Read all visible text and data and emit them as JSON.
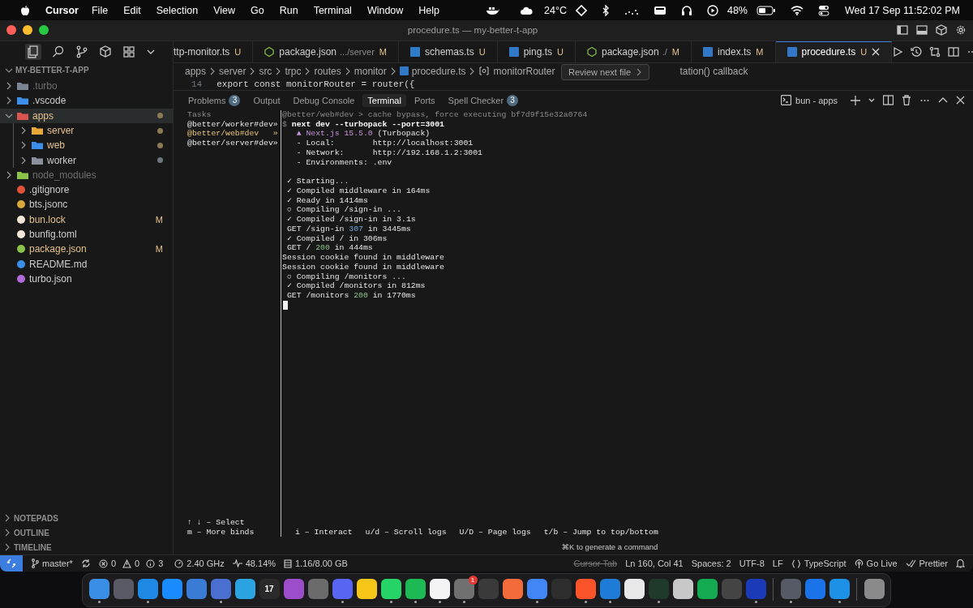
{
  "menu_bar": {
    "app": "Cursor",
    "menus": [
      "File",
      "Edit",
      "Selection",
      "View",
      "Go",
      "Run",
      "Terminal",
      "Window",
      "Help"
    ],
    "weather": "24°C",
    "battery": "48%",
    "clock": "Wed 17 Sep  11:52:02 PM"
  },
  "window": {
    "title": "procedure.ts — my-better-t-app"
  },
  "tabs": [
    {
      "label": "ttp-monitor.ts",
      "status": "U",
      "kind": "plain",
      "selected": false
    },
    {
      "label": "package.json",
      "detail": ".../server",
      "status": "M",
      "kind": "json",
      "selected": false
    },
    {
      "label": "schemas.ts",
      "status": "U",
      "kind": "ts",
      "selected": false
    },
    {
      "label": "ping.ts",
      "status": "U",
      "kind": "ts",
      "selected": false
    },
    {
      "label": "package.json",
      "detail": "./",
      "status": "M",
      "kind": "json",
      "selected": false
    },
    {
      "label": "index.ts",
      "status": "M",
      "kind": "ts",
      "selected": false
    },
    {
      "label": "procedure.ts",
      "status": "U",
      "kind": "ts",
      "selected": true
    }
  ],
  "tooltip": "Review next file",
  "breadcrumb": [
    "apps",
    "server",
    "src",
    "trpc",
    "routes",
    "monitor",
    "procedure.ts",
    "monitorRouter",
    "tation() callback"
  ],
  "code": {
    "line_number": "14",
    "text": "export const monitorRouter = router({"
  },
  "explorer": {
    "title": "MY-BETTER-T-APP",
    "items": [
      {
        "label": ".turbo",
        "kind": "folder",
        "color": "#7b8493",
        "dimmed": true,
        "modified": false,
        "expanded": false
      },
      {
        "label": ".vscode",
        "kind": "folder",
        "color": "#3b8eea",
        "dimmed": false,
        "modified": false,
        "expanded": false
      },
      {
        "label": "apps",
        "kind": "folder",
        "color": "#d9534f",
        "dimmed": false,
        "modified": true,
        "expanded": true,
        "changed": true,
        "children": [
          {
            "label": "server",
            "kind": "folder",
            "color": "#e8a838",
            "dimmed": false,
            "modified": true,
            "expanded": false,
            "changed": true
          },
          {
            "label": "web",
            "kind": "folder",
            "color": "#3b8eea",
            "dimmed": false,
            "modified": true,
            "expanded": false,
            "changed": true
          },
          {
            "label": "worker",
            "kind": "folder",
            "color": "#8a919c",
            "dimmed": false,
            "modified": false,
            "expanded": false,
            "changed": true
          }
        ]
      },
      {
        "label": "node_modules",
        "kind": "folder",
        "color": "#8bc34a",
        "dimmed": true,
        "modified": false,
        "expanded": false
      },
      {
        "label": ".gitignore",
        "kind": "file",
        "color": "#e0523a",
        "dimmed": false,
        "modified": false
      },
      {
        "label": "bts.jsonc",
        "kind": "file",
        "color": "#d9a83a",
        "dimmed": false,
        "modified": false
      },
      {
        "label": "bun.lock",
        "kind": "file",
        "color": "#f2e6d8",
        "dimmed": false,
        "modified": true,
        "badge": "M"
      },
      {
        "label": "bunfig.toml",
        "kind": "file",
        "color": "#f2e6d8",
        "dimmed": false,
        "modified": false
      },
      {
        "label": "package.json",
        "kind": "file",
        "color": "#8bc34a",
        "dimmed": false,
        "modified": true,
        "badge": "M"
      },
      {
        "label": "README.md",
        "kind": "file",
        "color": "#3b8eea",
        "dimmed": false,
        "modified": false
      },
      {
        "label": "turbo.json",
        "kind": "file",
        "color": "#b06ad9",
        "dimmed": false,
        "modified": false
      }
    ],
    "sections": [
      "NOTEPADS",
      "OUTLINE",
      "TIMELINE"
    ]
  },
  "panel": {
    "tabs": [
      {
        "label": "Problems",
        "count": "3",
        "selected": false
      },
      {
        "label": "Output",
        "selected": false
      },
      {
        "label": "Debug Console",
        "selected": false
      },
      {
        "label": "Terminal",
        "selected": true
      },
      {
        "label": "Ports",
        "selected": false
      },
      {
        "label": "Spell Checker",
        "count": "3",
        "selected": false
      }
    ],
    "terminal_name": "bun - apps",
    "tasks_title": "Tasks",
    "tasks": [
      {
        "label": "@better/worker#dev»",
        "selected": false
      },
      {
        "label": "@better/web#dev   »",
        "selected": true
      },
      {
        "label": "@better/server#dev»",
        "selected": false
      }
    ],
    "log": [
      {
        "segments": [
          {
            "text": "@better/web#dev > cache bypass, force executing bf7d9f15e32a0764",
            "kind": "dim"
          }
        ]
      },
      {
        "segments": [
          {
            "text": "$ ",
            "kind": "dim"
          },
          {
            "text": "next dev --turbopack --port=3001",
            "kind": "bold"
          }
        ]
      },
      {
        "segments": [
          {
            "text": "   ▲ Next.js 15.5.0",
            "kind": "purple"
          },
          {
            "text": " (Turbopack)",
            "kind": "plain"
          }
        ]
      },
      {
        "segments": [
          {
            "text": "   - Local:        http://localhost:3001",
            "kind": "plain"
          }
        ]
      },
      {
        "segments": [
          {
            "text": "   - Network:      http://192.168.1.2:3001",
            "kind": "plain"
          }
        ]
      },
      {
        "segments": [
          {
            "text": "   - Environments: .env",
            "kind": "plain"
          }
        ]
      },
      {
        "kind": "blank"
      },
      {
        "segments": [
          {
            "text": " ✓ Starting...",
            "kind": "plain"
          }
        ]
      },
      {
        "segments": [
          {
            "text": " ✓ Compiled middleware in 164ms",
            "kind": "plain"
          }
        ]
      },
      {
        "segments": [
          {
            "text": " ✓ Ready in 1414ms",
            "kind": "plain"
          }
        ]
      },
      {
        "segments": [
          {
            "text": " ○ Compiling /sign-in ...",
            "kind": "plain"
          }
        ]
      },
      {
        "segments": [
          {
            "text": " ✓ Compiled /sign-in in 3.1s",
            "kind": "plain"
          }
        ]
      },
      {
        "segments": [
          {
            "text": " GET /sign-in ",
            "kind": "plain"
          },
          {
            "text": "307",
            "kind": "blue"
          },
          {
            "text": " in 3445ms",
            "kind": "plain"
          }
        ]
      },
      {
        "segments": [
          {
            "text": " ✓ Compiled / in 306ms",
            "kind": "plain"
          }
        ]
      },
      {
        "segments": [
          {
            "text": " GET / ",
            "kind": "plain"
          },
          {
            "text": "200",
            "kind": "green"
          },
          {
            "text": " in 444ms",
            "kind": "plain"
          }
        ]
      },
      {
        "segments": [
          {
            "text": "Session cookie found in middleware",
            "kind": "plain"
          }
        ]
      },
      {
        "segments": [
          {
            "text": "Session cookie found in middleware",
            "kind": "plain"
          }
        ]
      },
      {
        "segments": [
          {
            "text": " ○ Compiling /monitors ...",
            "kind": "plain"
          }
        ]
      },
      {
        "segments": [
          {
            "text": " ✓ Compiled /monitors in 812ms",
            "kind": "plain"
          }
        ]
      },
      {
        "segments": [
          {
            "text": " GET /monitors ",
            "kind": "plain"
          },
          {
            "text": "200",
            "kind": "green"
          },
          {
            "text": " in 1770ms",
            "kind": "plain"
          }
        ]
      }
    ],
    "help_left": [
      "↑ ↓ – Select",
      "m – More binds"
    ],
    "help_right": [
      "i – Interact",
      "u/d – Scroll logs",
      "U/D – Page logs",
      "t/b – Jump to top/bottom"
    ],
    "ai_hint": "⌘K to generate a command"
  },
  "status_bar": {
    "branch": "master*",
    "errors": "0",
    "warnings": "0",
    "infos": "3",
    "cpu": "2.40 GHz",
    "load": "48.14%",
    "memory": "1.16/8.00 GB",
    "right": [
      {
        "label": "Cursor Tab",
        "disabled": true
      },
      {
        "label": "Ln 160, Col 41",
        "disabled": false
      },
      {
        "label": "Spaces: 2",
        "disabled": false
      },
      {
        "label": "UTF-8",
        "disabled": false
      },
      {
        "label": "LF",
        "disabled": false
      },
      {
        "label": "TypeScript",
        "disabled": false
      },
      {
        "label": "Go Live",
        "disabled": false
      },
      {
        "label": "Prettier",
        "disabled": false
      }
    ]
  },
  "dock": [
    {
      "color": "#3a8ee6",
      "running": true
    },
    {
      "color": "#5a5a66",
      "running": false
    },
    {
      "color": "#1e88e5",
      "running": true
    },
    {
      "color": "#1a8cff",
      "running": false
    },
    {
      "color": "#3a7bd5",
      "running": false
    },
    {
      "color": "#4a6fd0",
      "running": true
    },
    {
      "color": "#2aa3e0",
      "running": false
    },
    {
      "color": "#2a2a2a",
      "running": false,
      "text": "17"
    },
    {
      "color": "#9b4dca",
      "running": false
    },
    {
      "color": "#6b6b6b",
      "running": false
    },
    {
      "color": "#5865f2",
      "running": true
    },
    {
      "color": "#f5c518",
      "running": false
    },
    {
      "color": "#25d366",
      "running": true
    },
    {
      "color": "#1db954",
      "running": true
    },
    {
      "color": "#f4f4f4",
      "running": true
    },
    {
      "color": "#707070",
      "running": true,
      "badge": "1"
    },
    {
      "color": "#3a3a3a",
      "running": false
    },
    {
      "color": "#f26b3a",
      "running": false
    },
    {
      "color": "#4285f4",
      "running": true
    },
    {
      "color": "#2d2d2d",
      "running": false
    },
    {
      "color": "#fb542b",
      "running": true
    },
    {
      "color": "#1e7cd6",
      "running": true
    },
    {
      "color": "#e8e8e8",
      "running": false
    },
    {
      "color": "#1f3a2a",
      "running": true
    },
    {
      "color": "#c8c8c8",
      "running": false
    },
    {
      "color": "#13aa52",
      "running": false
    },
    {
      "color": "#444444",
      "running": false
    },
    {
      "color": "#1a3ab8",
      "running": true
    },
    {
      "kind": "separator"
    },
    {
      "color": "#555a66",
      "running": true
    },
    {
      "color": "#1a73e8",
      "running": false
    },
    {
      "color": "#1d91e6",
      "running": true
    },
    {
      "kind": "separator"
    },
    {
      "color": "#8a8a8a",
      "running": false
    }
  ]
}
